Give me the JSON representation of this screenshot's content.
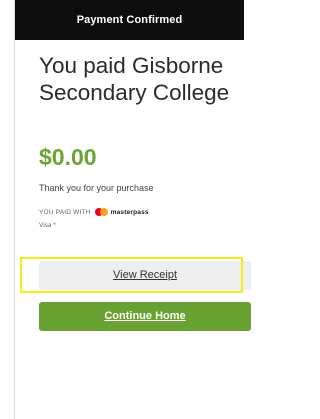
{
  "header": {
    "title": "Payment Confirmed"
  },
  "confirmation": {
    "paid_to": "You paid Gisborne Secondary College",
    "amount": "$0.00",
    "thanks": "Thank you for your purchase",
    "paid_with_label": "YOU PAID WITH",
    "wallet_name": "masterpass",
    "card_type": "Visa *"
  },
  "actions": {
    "view_receipt": "View Receipt",
    "continue_home": "Continue Home"
  },
  "colors": {
    "header_bg": "#0e0e0e",
    "amount": "#6ea436",
    "primary_button": "#69a233",
    "secondary_button": "#eeeeee",
    "highlight": "#f2ec17"
  },
  "icons": {
    "wallet_logo": "mastercard-logo-icon"
  }
}
